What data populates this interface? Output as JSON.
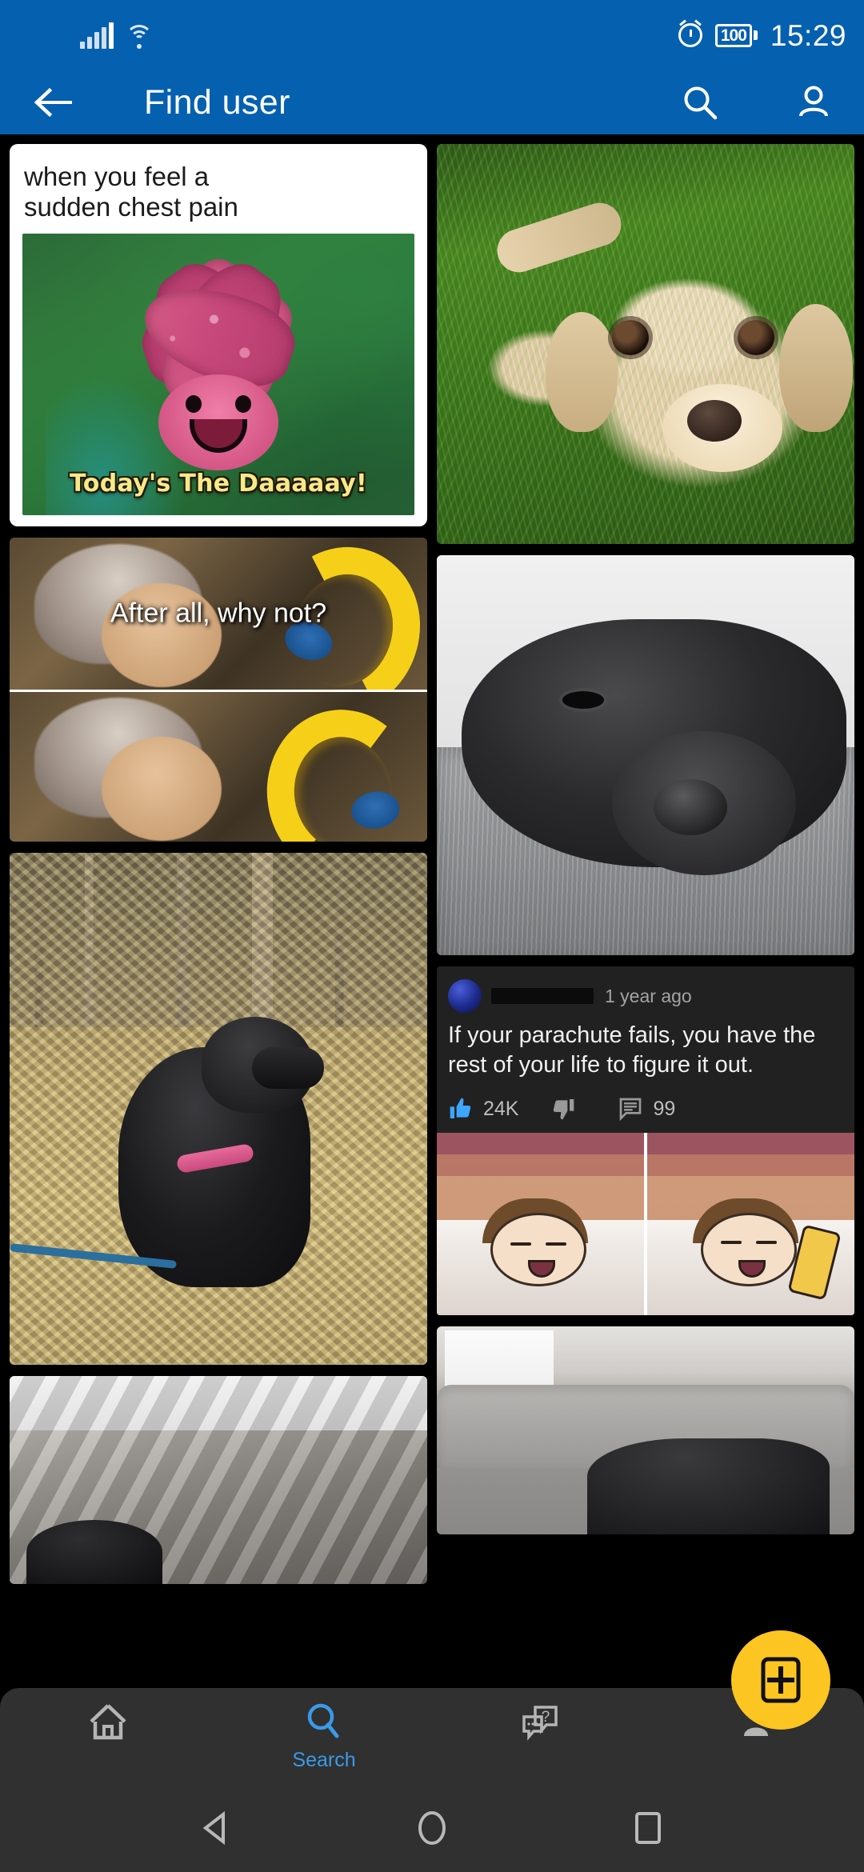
{
  "status_bar": {
    "time": "15:29",
    "battery_percent": "100",
    "icons": [
      "signal-icon",
      "wifi-icon",
      "alarm-icon",
      "battery-icon"
    ]
  },
  "app_bar": {
    "title": "Find user",
    "back_icon": "back-arrow-icon",
    "search_icon": "search-icon",
    "profile_icon": "person-icon",
    "background_color": "#0560b0"
  },
  "grid": {
    "cards": [
      {
        "id": "chest-pain-meme",
        "type": "meme-card",
        "caption": "when you feel a\nsudden chest pain",
        "caption_line1": "when you feel a",
        "caption_line2": "sudden chest pain",
        "image_text": "Today's The Daaaaay!",
        "image_alt": "pink starfish patrick smiling on green background"
      },
      {
        "id": "puppy-photo",
        "type": "photo",
        "image_alt": "yellow labrador puppy lying in green grass"
      },
      {
        "id": "bilbo-banana-meme",
        "type": "meme",
        "image_text": "After all, why not?",
        "image_alt": "Bilbo Baggins holding a banana two panel meme"
      },
      {
        "id": "black-dog-rug",
        "type": "photo",
        "image_alt": "black labrador sleeping on grey rug"
      },
      {
        "id": "dog-in-leaves",
        "type": "photo",
        "image_alt": "black labrador sitting on autumn leaves path"
      },
      {
        "id": "parachute-comment-meme",
        "type": "comment-meme",
        "comment": {
          "author": "",
          "timestamp": "1 year ago",
          "text_line1": "If your parachute fails, you have the",
          "text_line2": "rest of your life to figure it out.",
          "likes": "24K",
          "dislikes": "",
          "replies": "99",
          "like_icon": "thumbs-up-icon",
          "dislike_icon": "thumbs-down-icon",
          "reply_icon": "comment-icon",
          "like_color": "#3ea6ff"
        },
        "image_alt": "two panel cartoon of person lying in bed then awake on phone"
      },
      {
        "id": "blanket-dog",
        "type": "photo",
        "image_alt": "dog hidden under grey blanket"
      },
      {
        "id": "couch-dog",
        "type": "photo",
        "image_alt": "black dog lying on grey couch"
      }
    ]
  },
  "bottom_nav": {
    "items": [
      {
        "label": "",
        "icon": "home-icon",
        "active": false
      },
      {
        "label": "Search",
        "icon": "search-icon",
        "active": true
      },
      {
        "label": "",
        "icon": "question-chat-icon",
        "active": false
      },
      {
        "label": "",
        "icon": "person-icon",
        "active": false
      }
    ],
    "active_color": "#3a9ae8",
    "inactive_color": "#b5b5b5",
    "fab": {
      "icon": "add-post-icon",
      "color": "#fdc521"
    }
  },
  "android_nav": {
    "back": "triangle-back-icon",
    "home": "circle-home-icon",
    "recents": "square-recents-icon"
  }
}
